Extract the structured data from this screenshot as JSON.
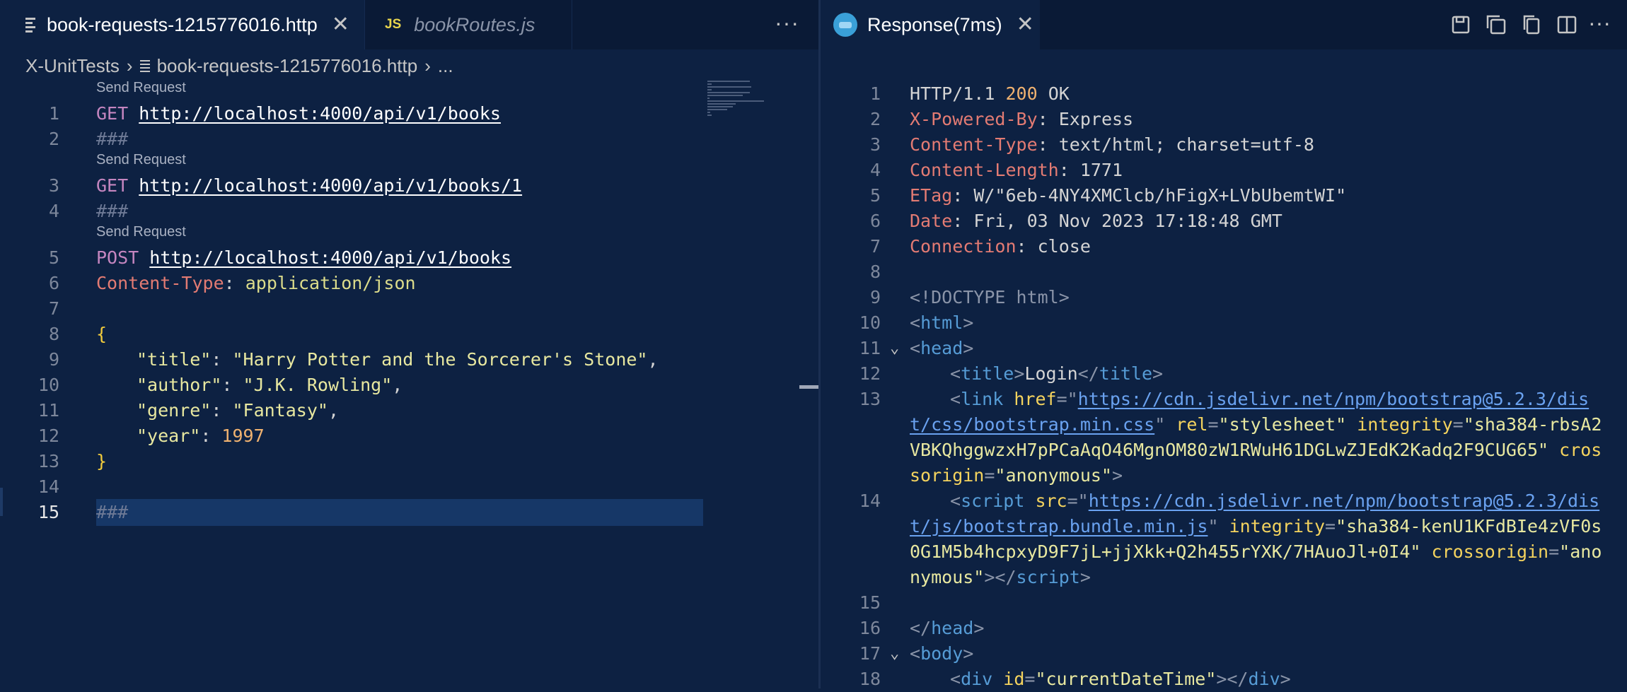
{
  "left_tabs": [
    {
      "label": "book-requests-1215776016.http",
      "icon": "http-file-icon"
    },
    {
      "label": "bookRoutes.js",
      "icon": "js-file-icon"
    }
  ],
  "js_icon_text": "JS",
  "more_actions": "···",
  "breadcrumb": {
    "folder": "X-UnitTests",
    "file": "book-requests-1215776016.http",
    "ellipsis": "..."
  },
  "codelens": "Send Request",
  "request_file": {
    "lines": [
      {
        "n": "1",
        "method": "GET",
        "url": "http://localhost:4000/api/v1/books"
      },
      {
        "n": "2",
        "sep": "###"
      },
      {
        "n": "3",
        "method": "GET",
        "url": "http://localhost:4000/api/v1/books/1"
      },
      {
        "n": "4",
        "sep": "###"
      },
      {
        "n": "5",
        "method": "POST",
        "url": "http://localhost:4000/api/v1/books"
      },
      {
        "n": "6",
        "header": "Content-Type",
        "value": "application/json"
      },
      {
        "n": "7"
      },
      {
        "n": "8",
        "text": "{"
      },
      {
        "n": "9",
        "key": "\"title\"",
        "value": "\"Harry Potter and the Sorcerer's Stone\""
      },
      {
        "n": "10",
        "key": "\"author\"",
        "value": "\"J.K. Rowling\""
      },
      {
        "n": "11",
        "key": "\"genre\"",
        "value": "\"Fantasy\""
      },
      {
        "n": "12",
        "key": "\"year\"",
        "value": "1997"
      },
      {
        "n": "13",
        "text": "}"
      },
      {
        "n": "14"
      },
      {
        "n": "15",
        "sep": "###"
      }
    ]
  },
  "response_tab": {
    "label": "Response(7ms)"
  },
  "response": {
    "status": {
      "n": "1",
      "protocol": "HTTP/1.1",
      "code": "200",
      "text": "OK"
    },
    "headers": [
      {
        "n": "2",
        "name": "X-Powered-By",
        "value": "Express"
      },
      {
        "n": "3",
        "name": "Content-Type",
        "value": "text/html; charset=utf-8"
      },
      {
        "n": "4",
        "name": "Content-Length",
        "value": "1771"
      },
      {
        "n": "5",
        "name": "ETag",
        "value": "W/\"6eb-4NY4XMClcb/hFigX+LVbUbemtWI\""
      },
      {
        "n": "6",
        "name": "Date",
        "value": "Fri, 03 Nov 2023 17:18:48 GMT"
      },
      {
        "n": "7",
        "name": "Connection",
        "value": "close"
      }
    ],
    "body": {
      "n8": "8",
      "doctype": "<!DOCTYPE html>",
      "n9": "9",
      "n10": "10",
      "html_tag": "html",
      "n11": "11",
      "head_tag": "head",
      "n12": "12",
      "title_tag": "title",
      "title_text": "Login",
      "n13": "13",
      "link_tag": "link",
      "href_attr": "href",
      "css_url_1": "https://cdn.jsdelivr.net/npm/bootstrap@5.2.3/dis",
      "css_url_2": "t/css/bootstrap.min.css",
      "rel_attr": "rel",
      "rel_val": "\"stylesheet\"",
      "integrity_attr": "integrity",
      "css_integrity_1": "\"sha384-rbsA2",
      "css_integrity_2": "VBKQhggwzxH7pPCaAqO46MgnOM80zW1RWuH61DGLwZJEdK2Kadq2F9CUG65\"",
      "cros_1": "cros",
      "cros_2": "sorigin",
      "anonymous": "\"anonymous\"",
      "n14": "14",
      "script_tag": "script",
      "src_attr": "src",
      "js_url_1": "https://cdn.jsdelivr.net/npm/bootstrap@5.2.3/dis",
      "js_url_2": "t/js/bootstrap.bundle.min.js",
      "js_integrity_1": "\"sha384-kenU1KFdBIe4zVF0s",
      "js_integrity_2": "0G1M5b4hcpxyD9F7jL+jjXkk+Q2h455rYXK/7HAuoJl+0I4\"",
      "crossorigin_attr": "crossorigin",
      "ano_1": "\"ano",
      "ano_2": "nymous\"",
      "n15": "15",
      "n16": "16",
      "n17": "17",
      "body_tag": "body",
      "n18": "18",
      "div_tag": "div",
      "id_attr": "id",
      "div_id": "\"currentDateTime\""
    }
  },
  "colors": {
    "background": "#0d2142",
    "tab_bar": "#0a1a36",
    "highlight": "#163767"
  }
}
